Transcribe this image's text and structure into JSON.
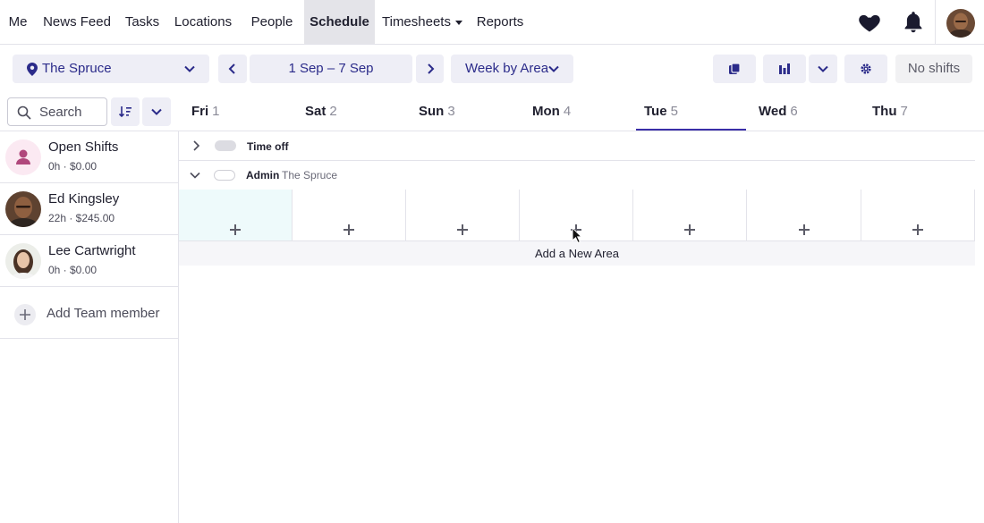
{
  "nav": {
    "items": [
      {
        "label": "Me"
      },
      {
        "label": "News Feed"
      },
      {
        "label": "Tasks"
      },
      {
        "label": "Locations"
      },
      {
        "label": "People"
      },
      {
        "label": "Schedule"
      },
      {
        "label": "Timesheets"
      },
      {
        "label": "Reports"
      }
    ],
    "active": "Schedule",
    "icons": [
      "heart-icon",
      "bell-icon",
      "avatar"
    ]
  },
  "toolbar": {
    "location": "The Spruce",
    "date_range": "1 Sep – 7 Sep",
    "view": "Week by Area",
    "status": "No shifts"
  },
  "search": {
    "placeholder": "Search"
  },
  "days": [
    {
      "name": "Fri",
      "num": "1"
    },
    {
      "name": "Sat",
      "num": "2"
    },
    {
      "name": "Sun",
      "num": "3"
    },
    {
      "name": "Mon",
      "num": "4"
    },
    {
      "name": "Tue",
      "num": "5"
    },
    {
      "name": "Wed",
      "num": "6"
    },
    {
      "name": "Thu",
      "num": "7"
    }
  ],
  "active_day": "Tue",
  "people": [
    {
      "name": "Open Shifts",
      "meta": "0h · $0.00"
    },
    {
      "name": "Ed Kingsley",
      "meta": "22h · $245.00"
    },
    {
      "name": "Lee Cartwright",
      "meta": "0h · $0.00"
    }
  ],
  "add_team_label": "Add Team member",
  "grid": {
    "time_off_label": "Time off",
    "area_label": "Admin",
    "area_location": "The Spruce",
    "add_area_label": "Add a New Area"
  },
  "colors": {
    "accent": "#3a2fa8",
    "toolbar_bg": "#eeeef6",
    "highlight_cell": "#eefafb",
    "open_shift_pink": "#fbe9f2",
    "open_shift_icon": "#b0487c"
  }
}
